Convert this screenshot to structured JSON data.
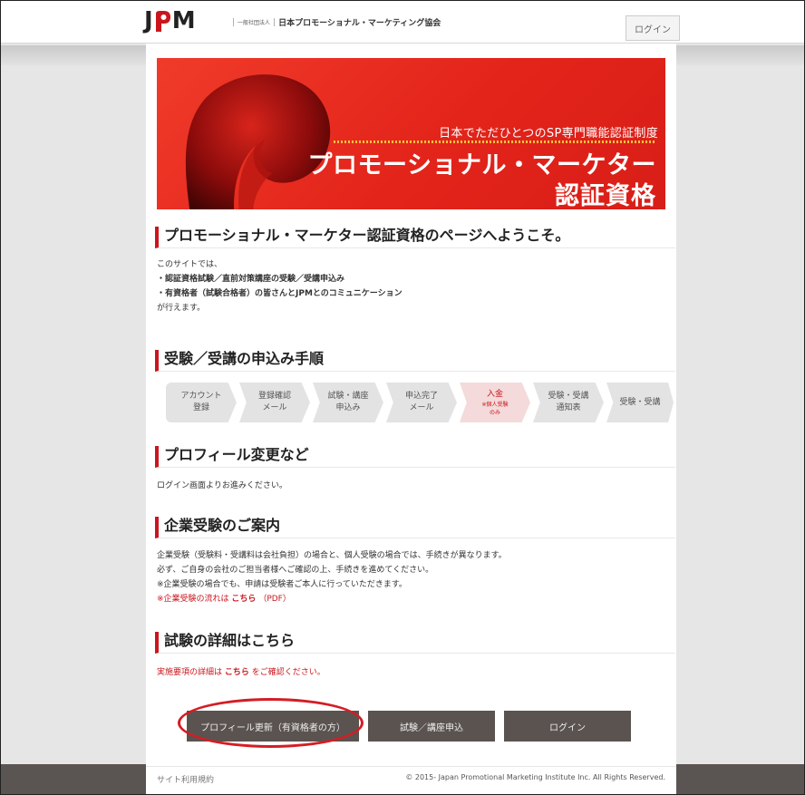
{
  "header": {
    "logo_left": "J",
    "logo_right": "M",
    "org_prefix": "一般社団法人",
    "org_name": "日本プロモーショナル・マーケティング協会",
    "login_label": "ログイン"
  },
  "hero": {
    "subtitle": "日本でただひとつのSP専門職能認証制度",
    "title_line1": "プロモーショナル・マーケター",
    "title_line2": "認証資格"
  },
  "welcome": {
    "heading": "プロモーショナル・マーケター認証資格のページへようこそ。",
    "intro": "このサイトでは、",
    "item1": "・認証資格試験／直前対策講座の受験／受講申込み",
    "item2": "・有資格者（試験合格者）の皆さんとJPMとのコミュニケーション",
    "outro": "が行えます。"
  },
  "procedure": {
    "heading": "受験／受講の申込み手順",
    "steps": [
      {
        "line1": "アカウント",
        "line2": "登録"
      },
      {
        "line1": "登録確認",
        "line2": "メール"
      },
      {
        "line1": "試験・講座",
        "line2": "申込み"
      },
      {
        "line1": "申込完了",
        "line2": "メール"
      },
      {
        "line1": "入金",
        "note1": "※個人受験",
        "note2": "のみ"
      },
      {
        "line1": "受験・受講",
        "line2": "通知表"
      },
      {
        "line1": "受験・受講"
      }
    ]
  },
  "profile": {
    "heading": "プロフィール変更など",
    "text": "ログイン画面よりお進みください。"
  },
  "corporate": {
    "heading": "企業受験のご案内",
    "line1": "企業受験（受験料・受講料は会社負担）の場合と、個人受験の場合では、手続きが異なります。",
    "line2": "必ず、ご自身の会社のご担当者様へご確認の上、手続きを進めてください。",
    "line3": "※企業受験の場合でも、申請は受験者ご本人に行っていただきます。",
    "line4_pre": "※企業受験の流れは",
    "line4_link": "こちら",
    "line4_post": "（PDF）"
  },
  "details": {
    "heading": "試験の詳細はこちら",
    "pre": "実施要項の詳細は",
    "link": "こちら",
    "post": "をご確認ください。"
  },
  "buttons": {
    "profile_update": "プロフィール更新（有資格者の方）",
    "apply": "試験／講座申込",
    "login": "ログイン"
  },
  "footer": {
    "terms": "サイト利用規約",
    "copyright": "© 2015- Japan Promotional Marketing Institute Inc. All Rights Reserved."
  },
  "colors": {
    "brand_red": "#c9161d",
    "hero_red": "#e3241a",
    "button_dark": "#5a5350"
  }
}
